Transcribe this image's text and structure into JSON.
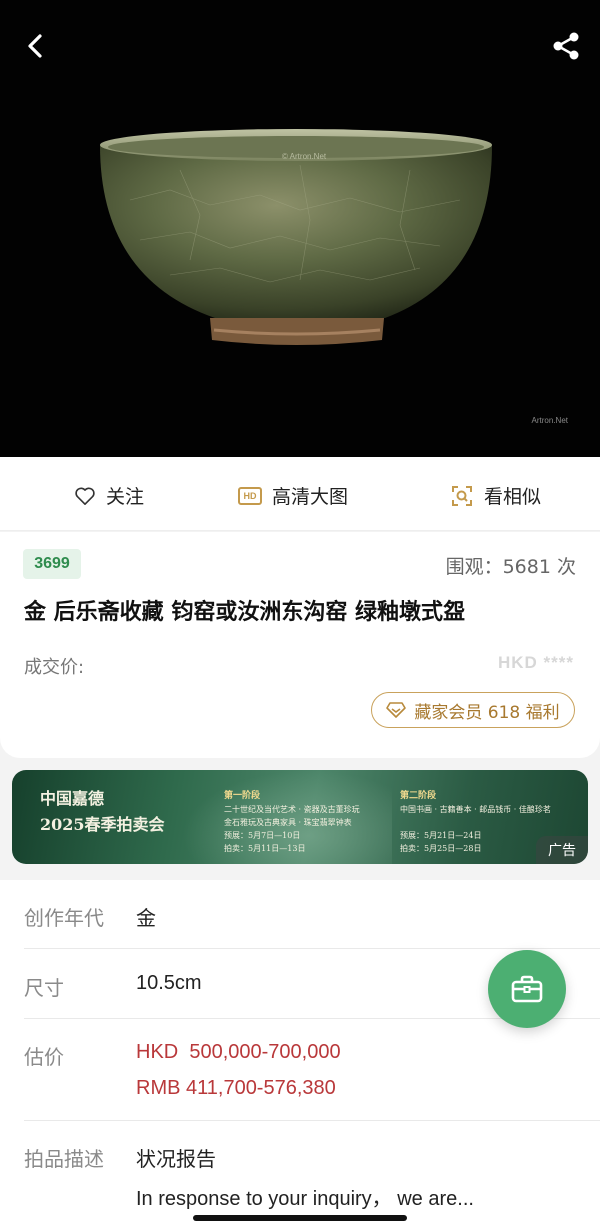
{
  "hero": {
    "watermark_top": "© Artron.Net",
    "watermark_bottom": "Artron.Net",
    "back_icon": "chevron-left-icon",
    "share_icon": "share-icon"
  },
  "actions": {
    "follow": "关注",
    "hd_badge": "HD",
    "hd_label": "高清大图",
    "similar": "看相似"
  },
  "lot": {
    "number": "3699",
    "views_label": "围观：",
    "views_count": "5681 次",
    "title": "金 后乐斋收藏 钧窑或汝洲东沟窑 绿釉墩式盌",
    "deal_label": "成交价:",
    "deal_value": "HKD ****",
    "vip_label": "藏家会员 618 福利"
  },
  "ad": {
    "brand_line1": "中国嘉德",
    "brand_line2": "2025春季拍卖会",
    "stage1_title": "第一阶段",
    "stage1_line1": "二十世纪及当代艺术 · 瓷器及古董珍玩",
    "stage1_line2": "金石雅玩及古典家具 · 珠宝翡翠钟表",
    "stage1_preview": "预展：5月7日—10日",
    "stage1_auction": "拍卖：5月11日—13日",
    "stage2_title": "第二阶段",
    "stage2_line1": "中国书画 · 古籍善本 · 邮品钱币 · 佳酿珍茗",
    "stage2_preview": "预展：5月21日—24日",
    "stage2_auction": "拍卖：5月25日—28日",
    "tag": "广告"
  },
  "details": {
    "era_label": "创作年代",
    "era_value": "金",
    "size_label": "尺寸",
    "size_value": "10.5cm",
    "estimate_label": "估价",
    "estimate_hkd": "HKD  500,000-700,000",
    "estimate_rmb": "RMB 411,700-576,380",
    "desc_label": "拍品描述",
    "desc_title": "状况报告",
    "desc_text": "In response to your inquiry， we are..."
  },
  "colors": {
    "accent_green": "#4caf72",
    "price_red": "#b9383a",
    "gold": "#c9a25c"
  }
}
